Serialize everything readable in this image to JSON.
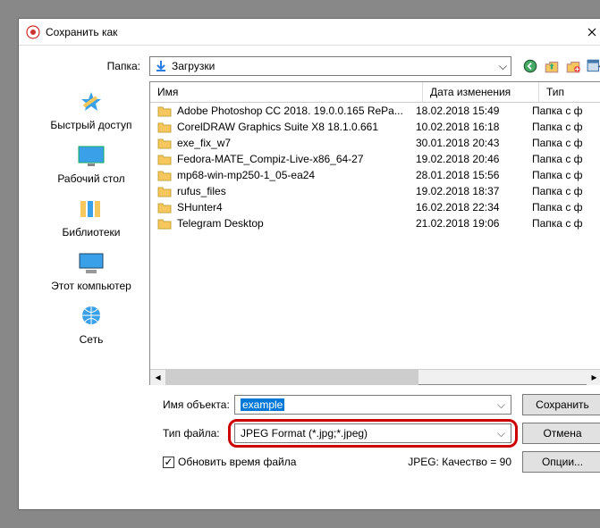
{
  "window": {
    "title": "Сохранить как"
  },
  "labels": {
    "folder": "Папка:",
    "filename": "Имя объекта:",
    "filetype": "Тип файла:",
    "update_time": "Обновить время файла",
    "quality": "JPEG: Качество = 90"
  },
  "folder_select": {
    "value": "Загрузки"
  },
  "columns": {
    "name": "Имя",
    "date": "Дата изменения",
    "type": "Тип"
  },
  "files": [
    {
      "name": "Adobe Photoshop CC 2018. 19.0.0.165 RePa...",
      "date": "18.02.2018 15:49",
      "type": "Папка с ф"
    },
    {
      "name": "CorelDRAW Graphics Suite X8 18.1.0.661",
      "date": "10.02.2018 16:18",
      "type": "Папка с ф"
    },
    {
      "name": "exe_fix_w7",
      "date": "30.01.2018 20:43",
      "type": "Папка с ф"
    },
    {
      "name": "Fedora-MATE_Compiz-Live-x86_64-27",
      "date": "19.02.2018 20:46",
      "type": "Папка с ф"
    },
    {
      "name": "mp68-win-mp250-1_05-ea24",
      "date": "28.01.2018 15:56",
      "type": "Папка с ф"
    },
    {
      "name": "rufus_files",
      "date": "19.02.2018 18:37",
      "type": "Папка с ф"
    },
    {
      "name": "SHunter4",
      "date": "16.02.2018 22:34",
      "type": "Папка с ф"
    },
    {
      "name": "Telegram Desktop",
      "date": "21.02.2018 19:06",
      "type": "Папка с ф"
    }
  ],
  "places": [
    {
      "id": "quick",
      "label": "Быстрый доступ"
    },
    {
      "id": "desktop",
      "label": "Рабочий стол"
    },
    {
      "id": "libraries",
      "label": "Библиотеки"
    },
    {
      "id": "computer",
      "label": "Этот компьютер"
    },
    {
      "id": "network",
      "label": "Сеть"
    }
  ],
  "filename_value": "example",
  "filetype_value": "JPEG Format (*.jpg;*.jpeg)",
  "buttons": {
    "save": "Сохранить",
    "cancel": "Отмена",
    "options": "Опции..."
  }
}
